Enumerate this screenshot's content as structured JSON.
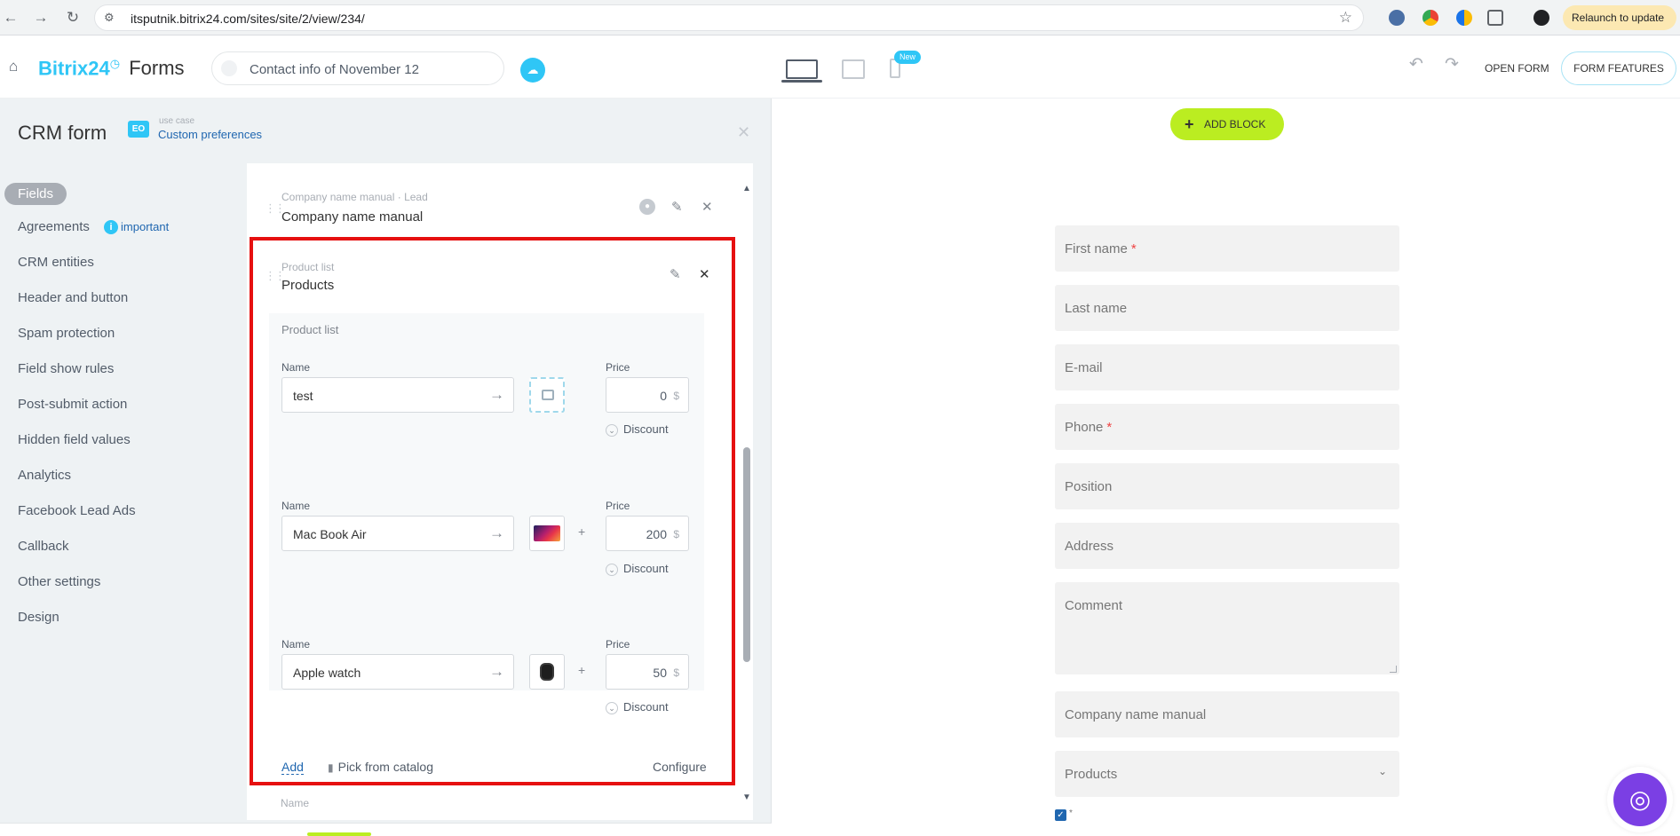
{
  "browser": {
    "back": "←",
    "forward": "→",
    "reload": "↻",
    "tune": "⚙",
    "url": "itsputnik.bitrix24.com/sites/site/2/view/234/",
    "star": "☆",
    "relaunch": "Relaunch to update ⋮"
  },
  "header": {
    "home": "⌂",
    "brand": "Bitrix24",
    "brand_clock": "◷",
    "product": "Forms",
    "form_name": "Contact info of November 12",
    "cloud": "☁",
    "new_badge": "New",
    "undo": "↶",
    "redo": "↷",
    "open_form": "OPEN FORM",
    "form_features": "FORM FEATURES"
  },
  "left_panel": {
    "title": "CRM form",
    "use_case_icon": "EO",
    "use_case_label": "use case",
    "use_case_value": "Custom preferences",
    "close": "✕"
  },
  "nav": {
    "fields": "Fields",
    "agreements": "Agreements",
    "important_dot": "i",
    "important": "important",
    "crm_entities": "CRM entities",
    "header_and_button": "Header and button",
    "spam_protection": "Spam protection",
    "field_show_rules": "Field show rules",
    "post_submit_action": "Post-submit action",
    "hidden_field_values": "Hidden field values",
    "analytics": "Analytics",
    "facebook_lead_ads": "Facebook Lead Ads",
    "callback": "Callback",
    "other_settings": "Other settings",
    "design": "Design"
  },
  "fields": {
    "drag": "⋮⋮",
    "company": {
      "type_label": "Company name manual · Lead",
      "title": "Company name manual",
      "user_icon": "●",
      "edit_icon": "✎",
      "remove_icon": "✕"
    },
    "products": {
      "type_label": "Product list",
      "title": "Products",
      "edit_icon": "✎",
      "remove_icon": "✕",
      "inner_label": "Product list",
      "name_label": "Name",
      "price_label": "Price",
      "arrow": "→",
      "plus": "+",
      "currency": "$",
      "discount": "Discount",
      "discount_chev": "⌄",
      "items": [
        {
          "name": "test",
          "price": "0"
        },
        {
          "name": "Mac Book Air",
          "price": "200"
        },
        {
          "name": "Apple watch",
          "price": "50"
        }
      ],
      "add": "Add",
      "pick_icon": "▮",
      "pick_from_catalog": "Pick from catalog",
      "configure": "Configure"
    },
    "next_peek": "Name",
    "scroll_up": "▲",
    "scroll_down": "▼"
  },
  "preview": {
    "add_block_plus": "+",
    "add_block": "ADD BLOCK",
    "fields": [
      {
        "label": "First name",
        "required": "*"
      },
      {
        "label": "Last name"
      },
      {
        "label": "E-mail"
      },
      {
        "label": "Phone",
        "required": "*"
      },
      {
        "label": "Position"
      },
      {
        "label": "Address"
      },
      {
        "label": "Comment"
      },
      {
        "label": "Company name manual"
      },
      {
        "label": "Products"
      }
    ],
    "select_chev": "⌄",
    "check": "✓",
    "check_star": "*",
    "assistant_icon": "◎"
  }
}
